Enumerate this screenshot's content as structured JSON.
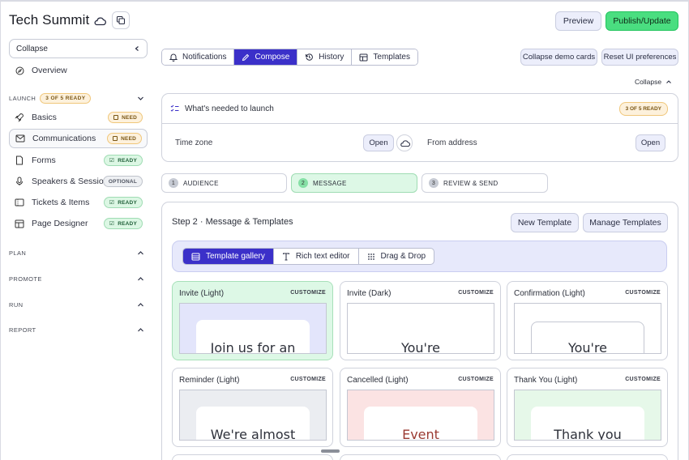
{
  "app": {
    "title": "Tech Summit"
  },
  "header": {
    "preview_label": "Preview",
    "publish_label": "Publish/Update"
  },
  "sidebar": {
    "collapse_label": "Collapse",
    "overview_label": "Overview",
    "launch": {
      "label": "LAUNCH",
      "badge": "3 OF 5 READY"
    },
    "items": [
      {
        "label": "Basics",
        "status": "NEED"
      },
      {
        "label": "Communications",
        "status": "NEED"
      },
      {
        "label": "Forms",
        "status": "READY"
      },
      {
        "label": "Speakers & Sessions",
        "status": "OPTIONAL"
      },
      {
        "label": "Tickets & Items",
        "status": "READY"
      },
      {
        "label": "Page Designer",
        "status": "READY"
      }
    ],
    "sections": [
      "PLAN",
      "PROMOTE",
      "RUN",
      "REPORT"
    ]
  },
  "tabs": [
    "Notifications",
    "Compose",
    "History",
    "Templates"
  ],
  "demo": {
    "collapse_cards_label": "Collapse demo cards",
    "reset_label": "Reset UI preferences",
    "collapse_label": "Collapse"
  },
  "launch_card": {
    "title": "What's needed to launch",
    "badge": "3 OF 5 READY",
    "timezone_label": "Time zone",
    "timezone_button": "Open",
    "from_label": "From address",
    "from_button": "Open"
  },
  "steps": [
    {
      "num": "1",
      "label": "AUDIENCE"
    },
    {
      "num": "2",
      "label": "MESSAGE"
    },
    {
      "num": "3",
      "label": "REVIEW & SEND"
    }
  ],
  "compose": {
    "title": "Step 2 · Message & Templates",
    "new_template_label": "New Template",
    "manage_templates_label": "Manage Templates",
    "modes": [
      "Template gallery",
      "Rich text editor",
      "Drag & Drop"
    ]
  },
  "templates": [
    {
      "name": "Invite (Light)",
      "action": "CUSTOMIZE",
      "preview": "Join us for an",
      "preview_bg": "#e3e5fb"
    },
    {
      "name": "Invite (Dark)",
      "action": "CUSTOMIZE",
      "preview": "You're",
      "preview_bg": "#ffffff"
    },
    {
      "name": "Confirmation (Light)",
      "action": "CUSTOMIZE",
      "preview": "You're",
      "preview_bg": "#ffffff"
    },
    {
      "name": "Reminder (Light)",
      "action": "CUSTOMIZE",
      "preview": "We're almost",
      "preview_bg": "#ebedf1"
    },
    {
      "name": "Cancelled (Light)",
      "action": "CUSTOMIZE",
      "preview": "Event",
      "preview_bg": "#fbe3e3"
    },
    {
      "name": "Thank You (Light)",
      "action": "CUSTOMIZE",
      "preview": "Thank you",
      "preview_bg": "#e6f8e9"
    }
  ],
  "colors": {
    "accent": "#3b30c9",
    "publish": "#4ade80",
    "ready": "#dcf7e4",
    "need": "#fdf1dc"
  }
}
